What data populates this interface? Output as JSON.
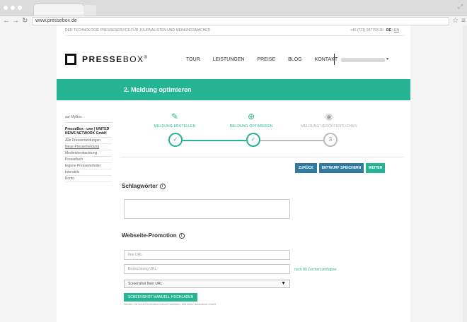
{
  "browser": {
    "url": "www.pressebox.de"
  },
  "topbar": {
    "tagline": "DER TECHNOLOGIE PRESSESERVICE FÜR JOURNALISTEN UND MEINUNGSMACHER",
    "phone": "+49 (721) 987793-30",
    "lang_de": "DE",
    "lang_sep": "|",
    "lang_en": "EN"
  },
  "logo": {
    "bold": "PRESSE",
    "light": "BOX",
    "mark": "®"
  },
  "nav": {
    "items": [
      "TOUR",
      "LEISTUNGEN",
      "PREISE",
      "BLOG",
      "KONTAKT"
    ]
  },
  "banner": {
    "title": "2. Meldung optimieren"
  },
  "sidebar": {
    "back": "zur MyBox",
    "company": "PresseBox - unn | UNITED NEWS NETWORK GmbH",
    "items": [
      "Alle Pressemeldungen",
      "Neue Pressemeldung",
      "Medienbeobachtung",
      "Pressefach",
      "Eigene Presseverteiler",
      "Interaktiv",
      "Konto"
    ]
  },
  "steps": [
    {
      "label": "MELDUNG ERSTELLEN",
      "icon": "edit-icon",
      "state": "✓"
    },
    {
      "label": "MELDUNG OPTIMIEREN",
      "icon": "plus-circle-icon",
      "state": "✓"
    },
    {
      "label": "MELDUNG VERÖFFENTLICHEN",
      "icon": "eye-icon",
      "state": "3"
    }
  ],
  "actions": {
    "back": "ZURÜCK",
    "save": "ENTWURF SPEICHERN",
    "next": "WEITER"
  },
  "keywords": {
    "heading": "Schlagwörter"
  },
  "promotion": {
    "heading": "Webseite-Promotion",
    "url_placeholder": "Ihre URL",
    "label_placeholder": "Bezeichnung URL",
    "char_count": "noch 80 Zeichen verfügbar",
    "select_value": "Screenshot Ihrer URL",
    "upload_button": "SCREENSHOT MANUELL HOCHLADEN",
    "hint": "Möchten Sie keinen Screenshot manuell hochladen, wird dieser automatisch erstellt."
  },
  "colors": {
    "accent": "#26b594",
    "button_blue": "#2f7a9e"
  }
}
